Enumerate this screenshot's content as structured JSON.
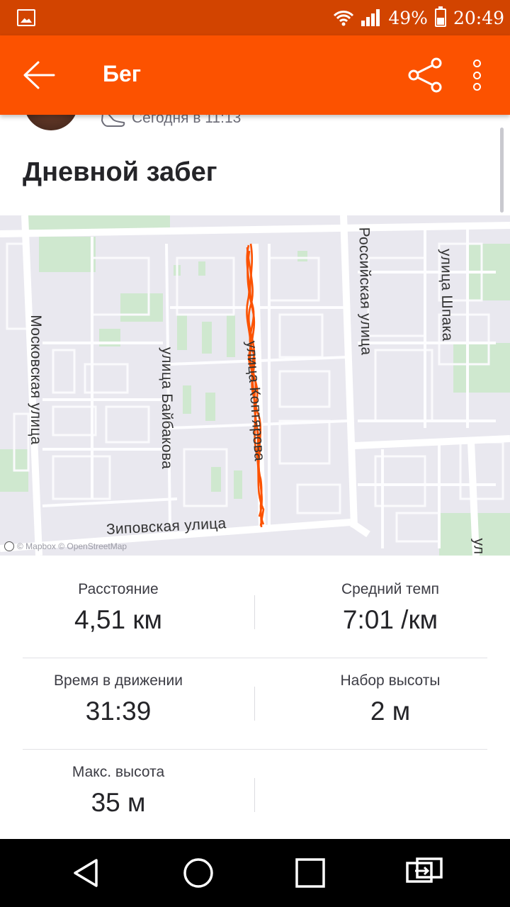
{
  "status_bar": {
    "battery": "49%",
    "time": "20:49",
    "gallery_icon": "image-icon",
    "wifi_icon": "wifi-icon",
    "signal_icon": "signal-icon",
    "battery_icon": "battery-icon"
  },
  "app_bar": {
    "title": "Бег",
    "back_icon": "arrow-back-icon",
    "share_icon": "share-icon",
    "more_icon": "more-vert-icon",
    "color": "#fc5200"
  },
  "activity": {
    "timestamp": "Сегодня в 11:13",
    "title": "Дневной забег"
  },
  "map": {
    "streets": [
      "Московская улица",
      "улица Байбакова",
      "улица Коптярова",
      "Зиповская улица",
      "Российская улица",
      "улица Шпака",
      "ул"
    ],
    "attribution": "© Mapbox © OpenStreetMap",
    "route_color": "#fc5200"
  },
  "stats": {
    "distance": {
      "label": "Расстояние",
      "value": "4,51 км"
    },
    "pace": {
      "label": "Средний темп",
      "value": "7:01 /км"
    },
    "moving_time": {
      "label": "Время в движении",
      "value": "31:39"
    },
    "elevation_gain": {
      "label": "Набор высоты",
      "value": "2 м"
    },
    "max_elevation": {
      "label": "Макс. высота",
      "value": "35 м"
    }
  },
  "nav_bar": {
    "back": "triangle-back-icon",
    "home": "circle-home-icon",
    "recents": "square-recents-icon",
    "switch": "switch-apps-icon"
  }
}
